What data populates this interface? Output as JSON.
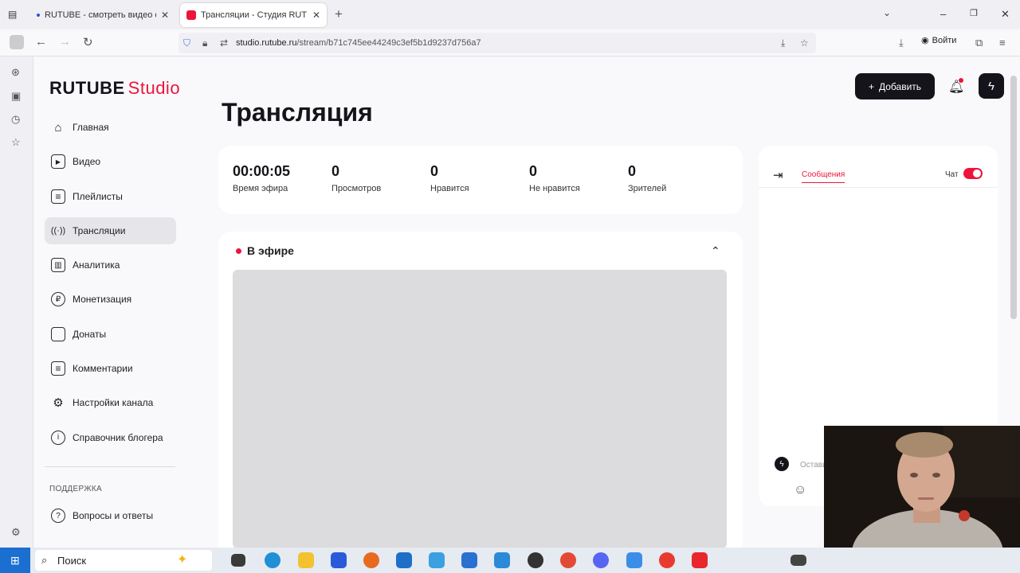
{
  "browser": {
    "tabs": [
      {
        "title": "RUTUBE - смотреть видео онл",
        "close": "✕"
      },
      {
        "title": "Трансляции - Студия RUTUBE",
        "close": "✕"
      }
    ],
    "new_tab": "+",
    "url_domain": "studio.rutube.ru",
    "url_path": "/stream/b71c745ee44249c3ef5b1d9237d756a7",
    "login_label": "Войти"
  },
  "logo": {
    "brand": "RUTUBE",
    "product": "Studio"
  },
  "header": {
    "add_label": "Добавить"
  },
  "sidebar": {
    "items": [
      {
        "label": "Главная",
        "icon": "home-icon",
        "glyph": "⌂"
      },
      {
        "label": "Видео",
        "icon": "video-icon",
        "glyph": "▶"
      },
      {
        "label": "Плейлисты",
        "icon": "playlist-icon",
        "glyph": "≡"
      },
      {
        "label": "Трансляции",
        "icon": "broadcast-icon",
        "glyph": "((·))"
      },
      {
        "label": "Аналитика",
        "icon": "analytics-icon",
        "glyph": "▥"
      },
      {
        "label": "Монетизация",
        "icon": "ruble-icon",
        "glyph": "₽"
      },
      {
        "label": "Донаты",
        "icon": "wallet-icon",
        "glyph": "▭"
      },
      {
        "label": "Комментарии",
        "icon": "comment-icon",
        "glyph": "≡"
      },
      {
        "label": "Настройки канала",
        "icon": "gear-icon",
        "glyph": "⚙"
      },
      {
        "label": "Справочник блогера",
        "icon": "info-icon",
        "glyph": "i"
      }
    ],
    "support_heading": "ПОДДЕРЖКА",
    "faq_label": "Вопросы и ответы"
  },
  "main": {
    "title": "Трансляция",
    "stats": [
      {
        "value": "00:00:05",
        "label": "Время эфира"
      },
      {
        "value": "0",
        "label": "Просмотров"
      },
      {
        "value": "0",
        "label": "Нравится"
      },
      {
        "value": "0",
        "label": "Не нравится"
      },
      {
        "value": "0",
        "label": "Зрителей"
      }
    ],
    "live_label": "В эфире"
  },
  "chat": {
    "tab_messages": "Сообщения",
    "chat_toggle_label": "Чат",
    "chat_enabled": true,
    "input_placeholder": "Оставить"
  },
  "taskbar": {
    "search_label": "Поиск"
  },
  "colors": {
    "accent": "#ed143b",
    "dark": "#14141a"
  }
}
